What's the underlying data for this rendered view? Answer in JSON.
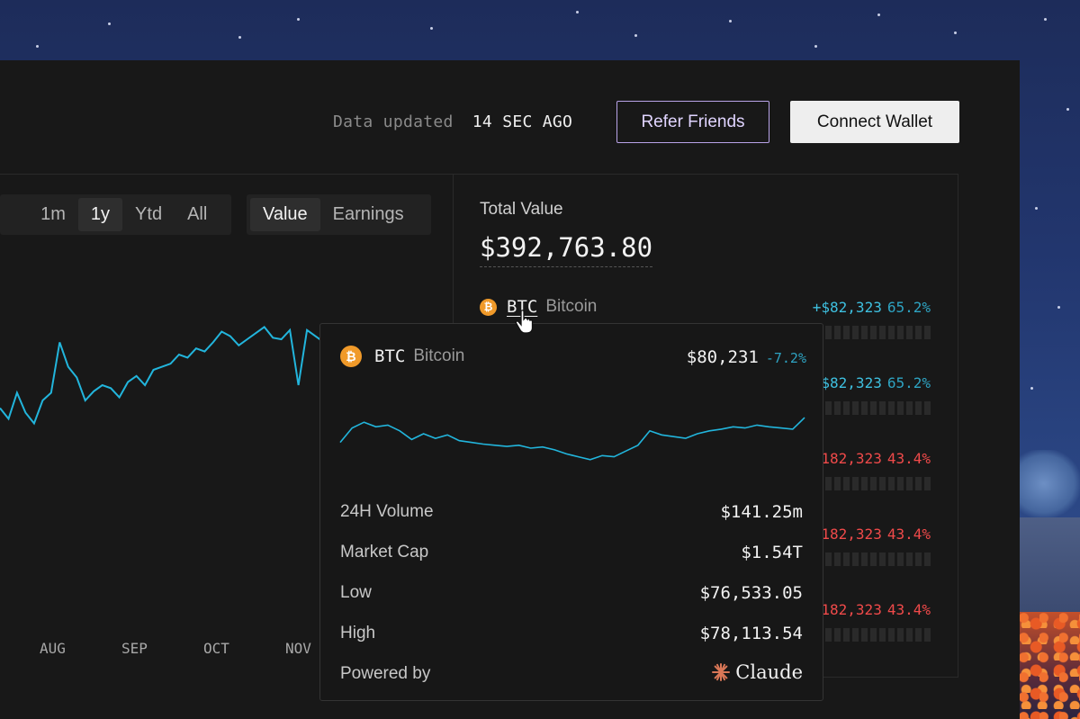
{
  "header": {
    "status_label": "Data updated",
    "status_value": "14 SEC AGO",
    "refer_label": "Refer Friends",
    "connect_label": "Connect Wallet"
  },
  "range_tabs": [
    "1m",
    "1y",
    "Ytd",
    "All"
  ],
  "range_active": "1y",
  "metric_tabs": [
    "Value",
    "Earnings"
  ],
  "metric_active": "Value",
  "chart_data": {
    "type": "line",
    "x_tick_labels": [
      "AUG",
      "SEP",
      "OCT",
      "NOV"
    ],
    "series": [
      {
        "values": [
          0.45,
          0.38,
          0.55,
          0.42,
          0.35,
          0.5,
          0.55,
          0.88,
          0.72,
          0.65,
          0.5,
          0.56,
          0.6,
          0.58,
          0.52,
          0.62,
          0.66,
          0.6,
          0.7,
          0.72,
          0.74,
          0.8,
          0.78,
          0.84,
          0.82,
          0.88,
          0.95,
          0.92,
          0.86,
          0.9,
          0.94,
          0.98,
          0.91,
          0.9,
          0.96,
          0.6,
          0.96,
          0.92,
          0.88
        ]
      }
    ]
  },
  "portfolio": {
    "total_label": "Total Value",
    "total_value": "$392,763.80",
    "assets": [
      {
        "symbol": "BTC",
        "name": "Bitcoin",
        "change": "+$82,323",
        "pct": "65.2%",
        "dir": "pos"
      },
      {
        "symbol": "",
        "name": "",
        "change": "+$82,323",
        "pct": "65.2%",
        "dir": "pos"
      },
      {
        "symbol": "",
        "name": "",
        "change": "-$182,323",
        "pct": "43.4%",
        "dir": "neg"
      },
      {
        "symbol": "",
        "name": "",
        "change": "-$182,323",
        "pct": "43.4%",
        "dir": "neg"
      },
      {
        "symbol": "",
        "name": "",
        "change": "-$182,323",
        "pct": "43.4%",
        "dir": "neg"
      }
    ]
  },
  "tooltip": {
    "symbol": "BTC",
    "name": "Bitcoin",
    "price": "$80,231",
    "pct": "-7.2%",
    "spark": [
      0.35,
      0.6,
      0.7,
      0.62,
      0.65,
      0.55,
      0.4,
      0.5,
      0.42,
      0.48,
      0.38,
      0.35,
      0.32,
      0.3,
      0.28,
      0.3,
      0.25,
      0.27,
      0.22,
      0.15,
      0.1,
      0.05,
      0.12,
      0.1,
      0.2,
      0.3,
      0.55,
      0.48,
      0.45,
      0.42,
      0.5,
      0.55,
      0.58,
      0.62,
      0.6,
      0.65,
      0.62,
      0.6,
      0.58,
      0.78
    ],
    "stats": [
      {
        "label": "24H Volume",
        "value": "$141.25m"
      },
      {
        "label": "Market Cap",
        "value": "$1.54T"
      },
      {
        "label": "Low",
        "value": "$76,533.05"
      },
      {
        "label": "High",
        "value": "$78,113.54"
      }
    ],
    "powered_label": "Powered by",
    "brand": "Claude"
  },
  "colors": {
    "accent": "#22b5dc",
    "negative": "#f04a4a",
    "btc": "#f09a2a",
    "claude": "#d97757"
  }
}
